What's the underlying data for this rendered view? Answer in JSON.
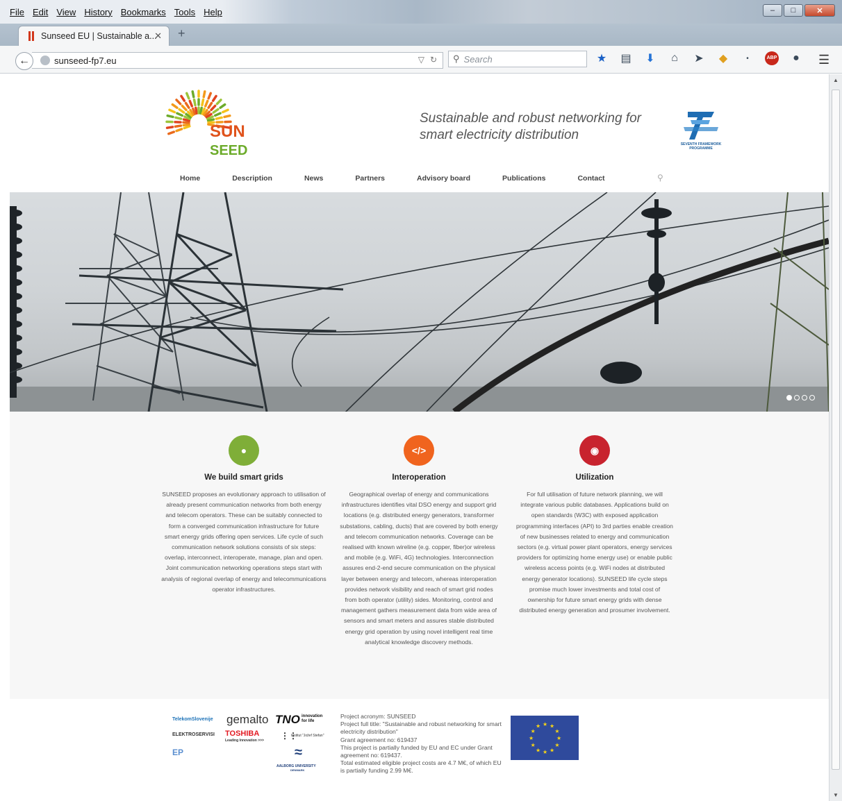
{
  "browser": {
    "menu": [
      "File",
      "Edit",
      "View",
      "History",
      "Bookmarks",
      "Tools",
      "Help"
    ],
    "tab_title": "Sunseed EU | Sustainable a...",
    "url": "sunseed-fp7.eu",
    "search_placeholder": "Search"
  },
  "site": {
    "logo_line1": "SUN",
    "logo_line2": "SEED",
    "tagline_line1": "Sustainable and robust networking for",
    "tagline_line2": "smart electricity distribution",
    "fp7_caption": "SEVENTH FRAMEWORK PROGRAMME",
    "nav": [
      "Home",
      "Description",
      "News",
      "Partners",
      "Advisory board",
      "Publications",
      "Contact"
    ]
  },
  "features": [
    {
      "title": "We build smart grids",
      "icon": "globe-icon",
      "color": "#7fae38",
      "text": "SUNSEED proposes an evolutionary approach to utilisation of already present communication networks from both energy and telecom operators. These can be suitably connected to form a converged communication infrastructure for future smart energy grids offering open services. Life cycle of such communication network solutions consists of six steps: overlap, interconnect, interoperate, manage, plan and open. Joint communication networking operations steps start with analysis of regional overlap of energy and telecommunications operator infrastructures."
    },
    {
      "title": "Interoperation",
      "icon": "code-icon",
      "color": "#f0641e",
      "text": "Geographical overlap of energy and communications infrastructures identifies vital DSO energy and support grid locations (e.g. distributed energy generators, transformer substations, cabling, ducts) that are covered by both energy and telecom communication networks. Coverage can be realised with known wireline (e.g. copper, fiber)or wireless and mobile (e.g. WiFi, 4G) technologies. Interconnection assures end-2-end secure communication on the physical layer between energy and telecom, whereas interoperation provides network visibility and reach of smart grid nodes from both operator (utility) sides. Monitoring, control and management gathers measurement data from wide area of sensors and smart meters and assures stable distributed energy grid operation by using novel intelligent real time analytical knowledge discovery methods."
    },
    {
      "title": "Utilization",
      "icon": "eye-icon",
      "color": "#c8232e",
      "text": "For full utilisation of future network planning, we will integrate various public databases. Applications build on open standards (W3C) with exposed application programming interfaces (API) to 3rd parties enable creation of new businesses related to energy and communication sectors (e.g. virtual power plant operators, energy services providers for optimizing home energy use) or enable public wireless access points (e.g. WiFi nodes at distributed energy generator locations). SUNSEED life cycle steps promise much lower investments and total cost of ownership for future smart energy grids with dense distributed energy generation and prosumer involvement."
    }
  ],
  "partners": {
    "telekom": "TelekomSlovenije",
    "gemalto": "gemalto",
    "tno": "TNO",
    "tno_tag": "innovation for life",
    "elektro": "ELEKTROSERVISI",
    "toshiba": "TOSHIBA",
    "toshiba_tag": "Leading Innovation >>>",
    "ijs": "Institut \"Jožef Stefan\"",
    "aau": "AALBORG UNIVERSITY",
    "aau_sub": "DENMARK",
    "ep": "EP"
  },
  "project_info": [
    "Project acronym: SUNSEED",
    "Project full title: \"Sustainable and robust networking for smart electricity distribution\"",
    "Grant agreement no: 619437",
    "This project is partially funded by EU and EC under Grant agreement no: 619437.",
    "Total estimated eligible project costs are 4.7 M€, of which EU is partially funding 2.99 M€."
  ]
}
